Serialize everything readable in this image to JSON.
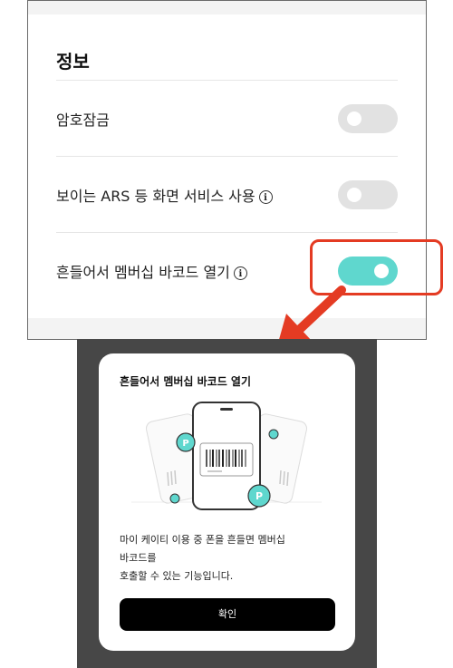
{
  "settings": {
    "section_title": "정보",
    "rows": [
      {
        "label": "암호잠금",
        "info": false,
        "toggle": "off"
      },
      {
        "label": "보이는 ARS 등 화면 서비스 사용",
        "info": true,
        "toggle": "off"
      },
      {
        "label": "흔들어서 멤버십 바코드 열기",
        "info": true,
        "toggle": "on"
      }
    ],
    "info_icon_glyph": "i"
  },
  "modal": {
    "title": "흔들어서 멤버십 바코드 열기",
    "badge_letter": "P",
    "description_lines": [
      "마이 케이티 이용 중 폰을 흔들면 멤버십",
      "바코드를",
      "호출할 수 있는 기능입니다."
    ],
    "confirm_label": "확인"
  },
  "colors": {
    "toggle_on": "#5fd7ce",
    "toggle_off": "#e2e2e2",
    "highlight": "#e43b23",
    "modal_backdrop": "#474747"
  }
}
